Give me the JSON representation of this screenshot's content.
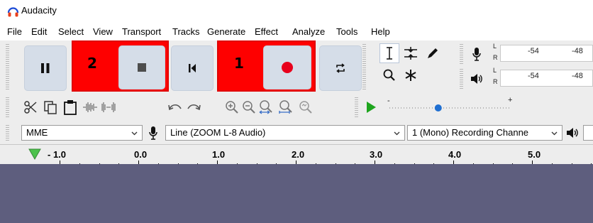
{
  "app": {
    "title": "Audacity"
  },
  "menu": [
    "File",
    "Edit",
    "Select",
    "View",
    "Transport",
    "Tracks",
    "Generate",
    "Effect",
    "Analyze",
    "Tools",
    "Help"
  ],
  "annotations": {
    "stop_marker": "2",
    "record_marker": "1"
  },
  "meters": {
    "record": {
      "ticks": [
        "-54",
        "-48"
      ],
      "l": "L",
      "r": "R"
    },
    "playback": {
      "ticks": [
        "-54",
        "-48"
      ],
      "l": "L",
      "r": "R"
    }
  },
  "play_at_speed": {
    "slider_value": 0.4,
    "scale_left": "-",
    "scale_right": "+"
  },
  "devices": {
    "host": "MME",
    "recording_device": "Line (ZOOM L-8 Audio)",
    "recording_channels": "1 (Mono) Recording Channe"
  },
  "timeline": {
    "labels": [
      "- 1.0",
      "0.0",
      "1.0",
      "2.0",
      "3.0",
      "4.0",
      "5.0"
    ]
  },
  "colors": {
    "highlight": "#fe0000",
    "record": "#e8001c",
    "play_green": "#1ea51e",
    "track_bg": "#5e5e7e"
  }
}
